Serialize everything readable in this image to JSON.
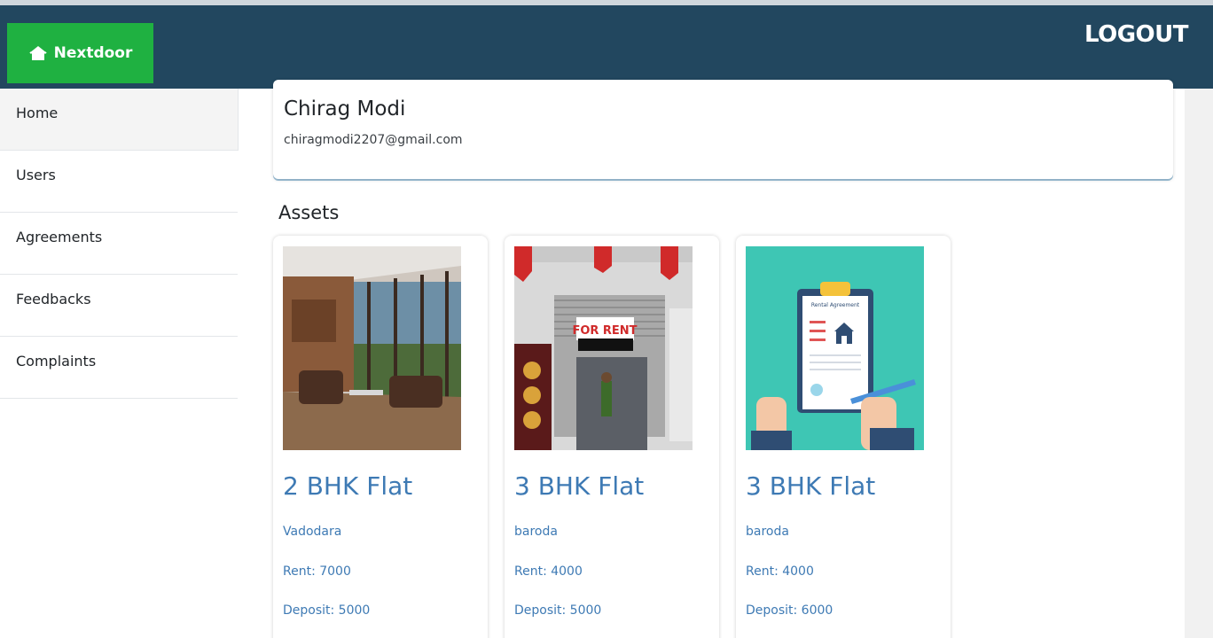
{
  "header": {
    "brand": "Nextdoor",
    "logout_label": "LOGOUT",
    "bar_color": "#22475f",
    "brand_color": "#1fb141"
  },
  "sidebar": {
    "items": [
      {
        "label": "Home",
        "active": true
      },
      {
        "label": "Users"
      },
      {
        "label": "Agreements"
      },
      {
        "label": "Feedbacks"
      },
      {
        "label": "Complaints"
      }
    ]
  },
  "profile": {
    "name": "Chirag Modi",
    "email": "chiragmodi2207@gmail.com"
  },
  "assets": {
    "title": "Assets",
    "items": [
      {
        "title": "2 BHK Flat",
        "city": "Vadodara",
        "rent": "Rent: 7000",
        "deposit": "Deposit: 5000",
        "image": "living-room-photo"
      },
      {
        "title": "3 BHK Flat",
        "city": "baroda",
        "rent": "Rent: 4000",
        "deposit": "Deposit: 5000",
        "image": "for-rent-shop-photo",
        "image_text": "FOR RENT"
      },
      {
        "title": "3 BHK Flat",
        "city": "baroda",
        "rent": "Rent: 4000",
        "deposit": "Deposit: 6000",
        "image": "rental-agreement-illustration",
        "image_text": "Rental Agreement"
      }
    ]
  }
}
